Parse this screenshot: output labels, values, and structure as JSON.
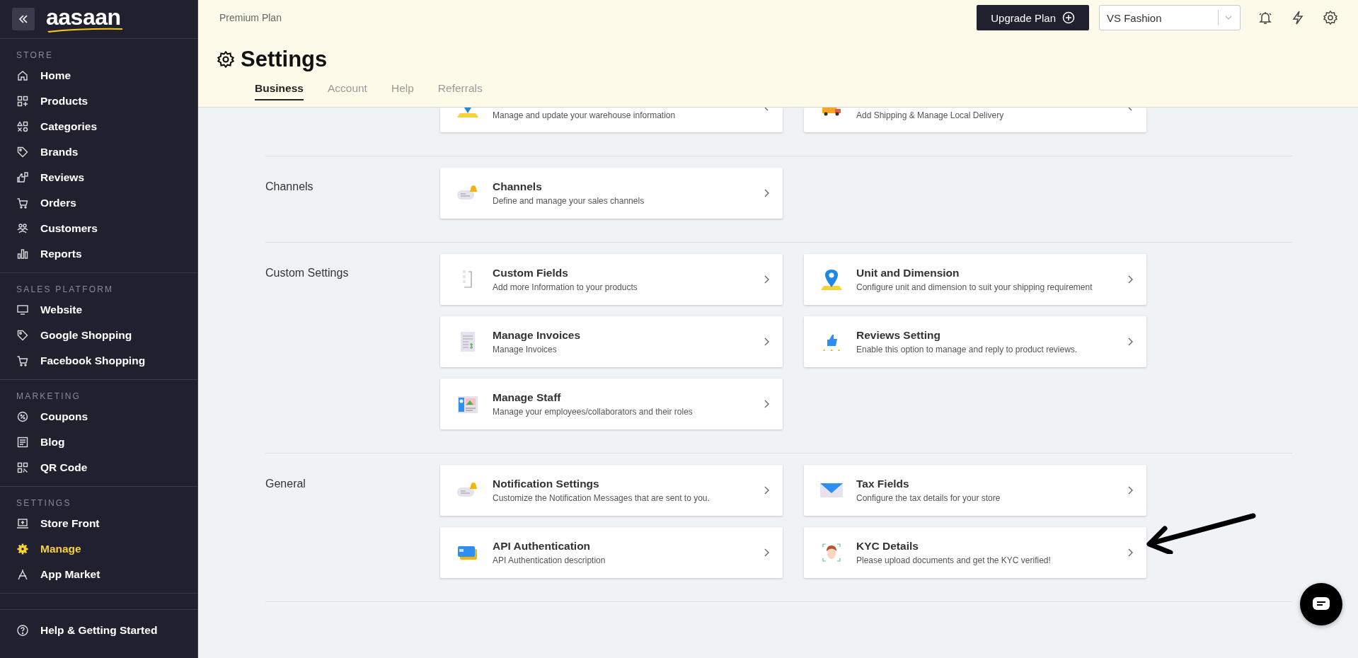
{
  "sidebar": {
    "logo": "aasaan",
    "sections": [
      {
        "title": "STORE",
        "items": [
          {
            "label": "Home",
            "selected": false
          },
          {
            "label": "Products",
            "selected": false
          },
          {
            "label": "Categories",
            "selected": false
          },
          {
            "label": "Brands",
            "selected": false
          },
          {
            "label": "Reviews",
            "selected": false
          },
          {
            "label": "Orders",
            "selected": false
          },
          {
            "label": "Customers",
            "selected": false
          },
          {
            "label": "Reports",
            "selected": false
          }
        ]
      },
      {
        "title": "SALES PLATFORM",
        "items": [
          {
            "label": "Website",
            "selected": false
          },
          {
            "label": "Google Shopping",
            "selected": false
          },
          {
            "label": "Facebook Shopping",
            "selected": false
          }
        ]
      },
      {
        "title": "MARKETING",
        "items": [
          {
            "label": "Coupons",
            "selected": false
          },
          {
            "label": "Blog",
            "selected": false
          },
          {
            "label": "QR Code",
            "selected": false
          }
        ]
      },
      {
        "title": "SETTINGS",
        "items": [
          {
            "label": "Store Front",
            "selected": false
          },
          {
            "label": "Manage",
            "selected": true
          },
          {
            "label": "App Market",
            "selected": false
          }
        ]
      }
    ],
    "footer": {
      "label": "Help & Getting Started"
    }
  },
  "header": {
    "plan": "Premium Plan",
    "upgrade_button": "Upgrade Plan",
    "store_select": {
      "value": "VS Fashion"
    },
    "title": "Settings",
    "tabs": [
      {
        "label": "Business",
        "selected": true
      },
      {
        "label": "Account",
        "selected": false
      },
      {
        "label": "Help",
        "selected": false
      },
      {
        "label": "Referrals",
        "selected": false
      }
    ]
  },
  "sections": [
    {
      "cards": [
        {
          "kind": "clipped",
          "description": "Manage and update your warehouse information"
        },
        {
          "kind": "clipped",
          "description": "Add Shipping & Manage Local Delivery"
        }
      ]
    },
    {
      "label": "Channels",
      "cards": [
        {
          "kind": "full",
          "title": "Channels",
          "description": "Define and manage your sales channels"
        }
      ]
    },
    {
      "label": "Custom Settings",
      "cards": [
        {
          "kind": "full",
          "title": "Custom Fields",
          "description": "Add more Information to your products"
        },
        {
          "kind": "full",
          "title": "Unit and Dimension",
          "description": "Configure unit and dimension to suit your shipping requirement"
        },
        {
          "kind": "full",
          "title": "Manage Invoices",
          "description": "Manage Invoices"
        },
        {
          "kind": "full",
          "title": "Reviews Setting",
          "description": "Enable this option to manage and reply to product reviews."
        },
        {
          "kind": "full",
          "title": "Manage Staff",
          "description": "Manage your employees/collaborators and their roles"
        }
      ]
    },
    {
      "label": "General",
      "cards": [
        {
          "kind": "full",
          "title": "Notification Settings",
          "description": "Customize the Notification Messages that are sent to you."
        },
        {
          "kind": "full",
          "title": "Tax Fields",
          "description": "Configure the tax details for your store"
        },
        {
          "kind": "full",
          "title": "API Authentication",
          "description": "API Authentication description"
        },
        {
          "kind": "full",
          "title": "KYC Details",
          "description": "Please upload documents and get the KYC verified!"
        }
      ]
    }
  ]
}
